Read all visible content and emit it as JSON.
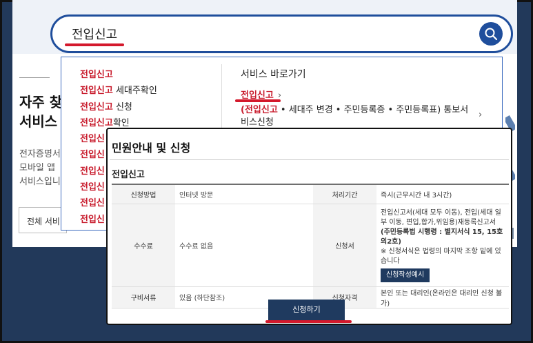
{
  "search": {
    "query": "전입신고"
  },
  "background": {
    "title_line1": "자주 찾",
    "title_line2": "서비스",
    "desc_line1": "전자증명서",
    "desc_line2": "모바일 앱",
    "desc_line3": "서비스입니",
    "all_button": "전체 서비"
  },
  "dropdown": {
    "suggestions": [
      {
        "hl": "전입신고",
        "rest": ""
      },
      {
        "hl": "전입신고",
        "rest": " 세대주확인"
      },
      {
        "hl": "전입신고",
        "rest": " 신청"
      },
      {
        "hl": "전입신고",
        "rest": "확인"
      },
      {
        "hl": "전입신",
        "rest": ""
      },
      {
        "hl": "전입신",
        "rest": ""
      },
      {
        "hl": "전입신",
        "rest": ""
      },
      {
        "hl": "전입신",
        "rest": ""
      },
      {
        "hl": "전입신",
        "rest": ""
      },
      {
        "hl": "전입신",
        "rest": ""
      }
    ],
    "shortcut_title": "서비스 바로가기",
    "shortcut_link": "전입신고",
    "shortcut_arrow": "›",
    "shortcut_desc_hl": "(전입신고",
    "shortcut_desc_rest": " • 세대주 변경 • 주민등록증 • 주민등록표) 통보서비스신청",
    "shortcut_desc_arrow": "›"
  },
  "modal": {
    "title": "민원안내 및 신청",
    "subtitle": "전입신고",
    "rows": {
      "method_label": "신청방법",
      "method_value": "인터넷 방문",
      "period_label": "처리기간",
      "period_value": "즉시(근무시간 내 3시간)",
      "fee_label": "수수료",
      "fee_value": "수수료 없음",
      "form_label": "신청서",
      "form_desc_1": "전입신고서(세대 모두 이동), 전입(세대 일부 이동, 편입,합가,위임용)재등록신고서 ",
      "form_desc_bold": "(주민등록법 시행령 : 별지서식 15, 15호의2호)",
      "form_desc_2": "※ 신청서식은 법령의 마지막 조항 밑에 있습니다",
      "form_sample_button": "신청작성예시",
      "docs_label": "구비서류",
      "docs_value": "있음 (하단참조)",
      "qualification_label": "신청자격",
      "qualification_value": "본인 또는 대리인(온라인은 대리인 신청 불가)"
    },
    "apply_button": "신청하기"
  },
  "colors": {
    "highlight_red": "#c81b2c",
    "navy": "#1f3a5f",
    "search_border": "#1f4e9c"
  }
}
